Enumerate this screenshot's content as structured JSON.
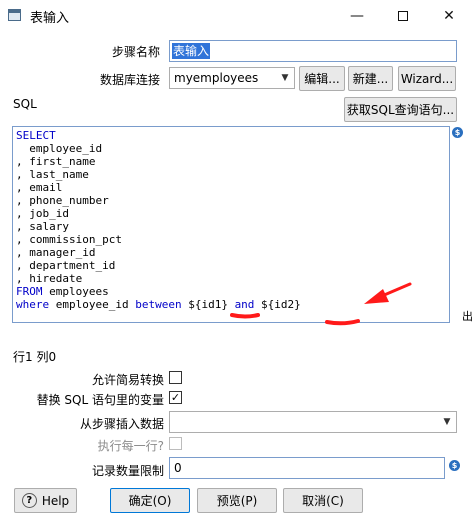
{
  "window": {
    "title": "表输入",
    "minimize_symbol": "—",
    "close_symbol": "✕"
  },
  "form": {
    "step_name_label": "步骤名称",
    "step_name_value": "表输入",
    "db_connection_label": "数据库连接",
    "db_connection_value": "myemployees",
    "edit_button": "编辑...",
    "new_button": "新建...",
    "wizard_button": "Wizard...",
    "sql_label": "SQL",
    "get_sql_button": "获取SQL查询语句...",
    "sql_lines": [
      "SELECT",
      "  employee_id",
      ", first_name",
      ", last_name",
      ", email",
      ", phone_number",
      ", job_id",
      ", salary",
      ", commission_pct",
      ", manager_id",
      ", department_id",
      ", hiredate",
      "FROM employees",
      "where employee_id between ${id1} and ${id2}"
    ],
    "sql_select_kw": "SELECT",
    "sql_from_kw": "FROM",
    "sql_from_rest": " employees",
    "sql_where_kw": "where",
    "sql_where_mid": " employee_id ",
    "sql_between_kw": "between",
    "sql_var1": " ${id1} ",
    "sql_and_kw": "and",
    "sql_var2": " ${id2}",
    "cursor_position": "行1 列0",
    "lazy_conversion_label": "允许简易转换",
    "lazy_conversion_checked": false,
    "replace_vars_label": "替换 SQL 语句里的变量",
    "replace_vars_checked": true,
    "replace_vars_mark": "✓",
    "insert_from_step_label": "从步骤插入数据",
    "insert_from_step_value": "",
    "execute_each_row_label": "执行每一行?",
    "execute_each_row_checked": false,
    "limit_label": "记录数量限制",
    "limit_value": "0",
    "variable_icon_symbol": "$",
    "side_fragment": "出"
  },
  "footer": {
    "help_button": "Help",
    "help_icon_symbol": "?",
    "ok_button": "确定(O)",
    "preview_button": "预览(P)",
    "cancel_button": "取消(C)"
  },
  "annotation_color": "#ff1a1a"
}
